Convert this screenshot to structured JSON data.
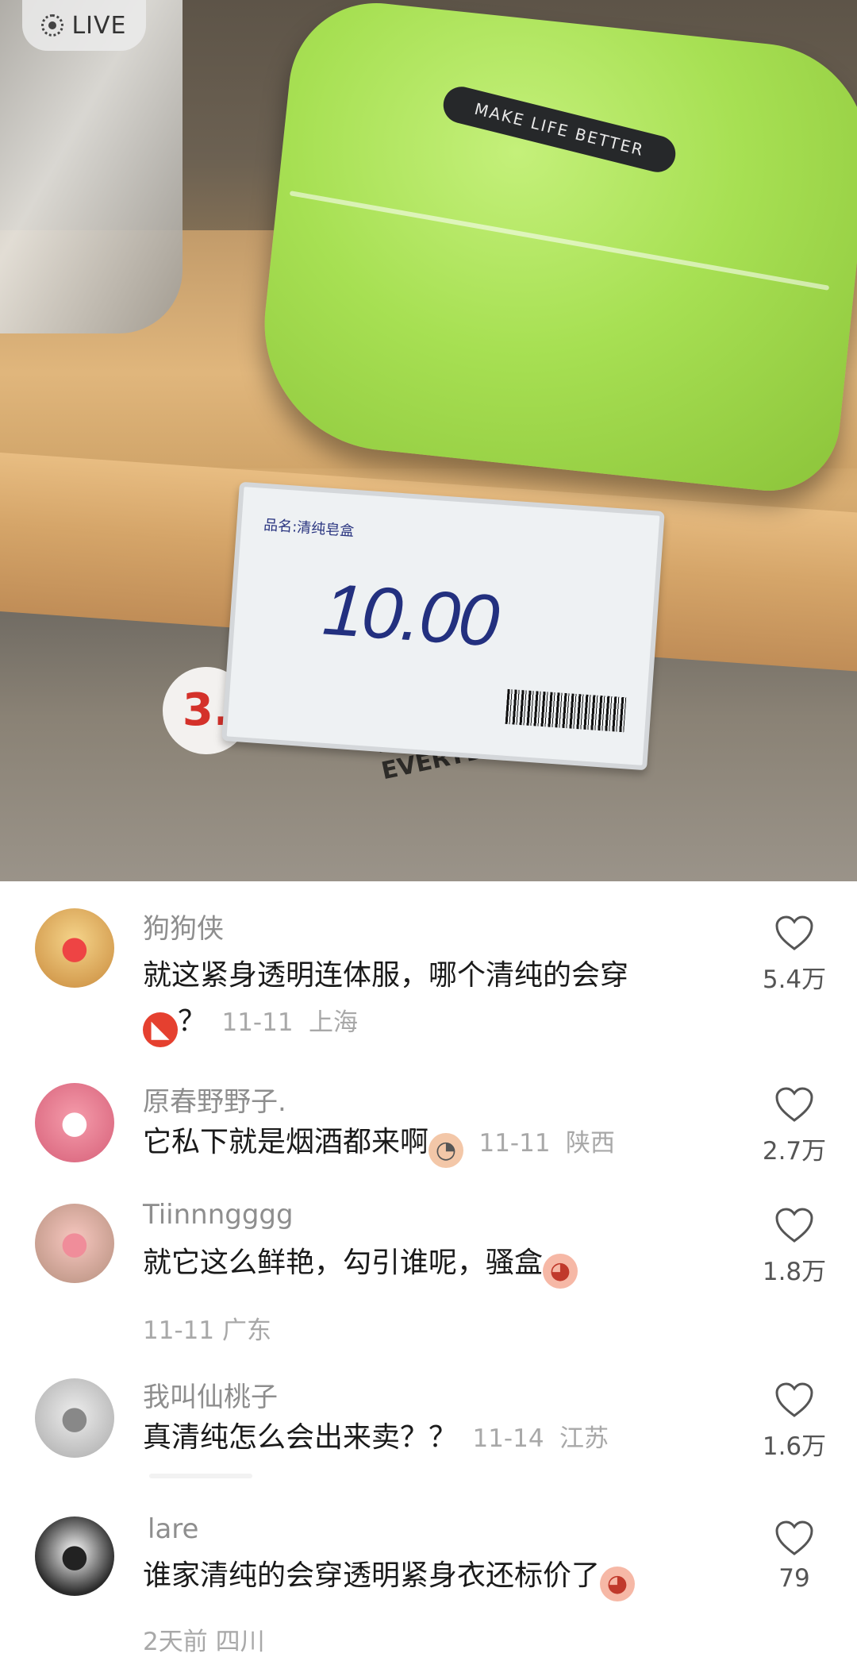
{
  "live_badge": {
    "label": "LIVE"
  },
  "photo": {
    "box_label": "MAKE LIFE BETTER",
    "tag_name": "品名:清纯皂盒",
    "price": "10.00",
    "sign_text": "HEY LIFE HIGH EVERYDAY",
    "bg_price": "3."
  },
  "comments": [
    {
      "user": "狗狗侠",
      "text": "就这紧身透明连体服，哪个清纯的会穿",
      "text2": "？",
      "date": "11-11",
      "location": "上海",
      "likes": "5.4万",
      "avatar_icon": "bear-hat-avatar",
      "emoji_icon": "angry-face-emoji"
    },
    {
      "user": "原春野野子.",
      "text": "它私下就是烟酒都来啊",
      "date": "11-11",
      "location": "陕西",
      "likes": "2.7万",
      "avatar_icon": "pink-pig-avatar",
      "emoji_icon": "smoking-face-emoji"
    },
    {
      "user": "Tiinnngggg",
      "text": "就它这么鲜艳，勾引谁呢，骚盒",
      "date": "11-11",
      "location": "广东",
      "likes": "1.8万",
      "avatar_icon": "pink-doll-avatar",
      "emoji_icon": "shy-face-emoji"
    },
    {
      "user": "我叫仙桃子",
      "text": "真清纯怎么会出来卖？？",
      "date": "11-14",
      "location": "江苏",
      "likes": "1.6万",
      "avatar_icon": "rabbit-avatar"
    },
    {
      "user": "lare",
      "text": "谁家清纯的会穿透明紧身衣还标价了",
      "date": "2天前",
      "location": "四川",
      "likes": "79",
      "avatar_icon": "puppy-avatar",
      "emoji_icon": "shy-face-emoji"
    }
  ]
}
